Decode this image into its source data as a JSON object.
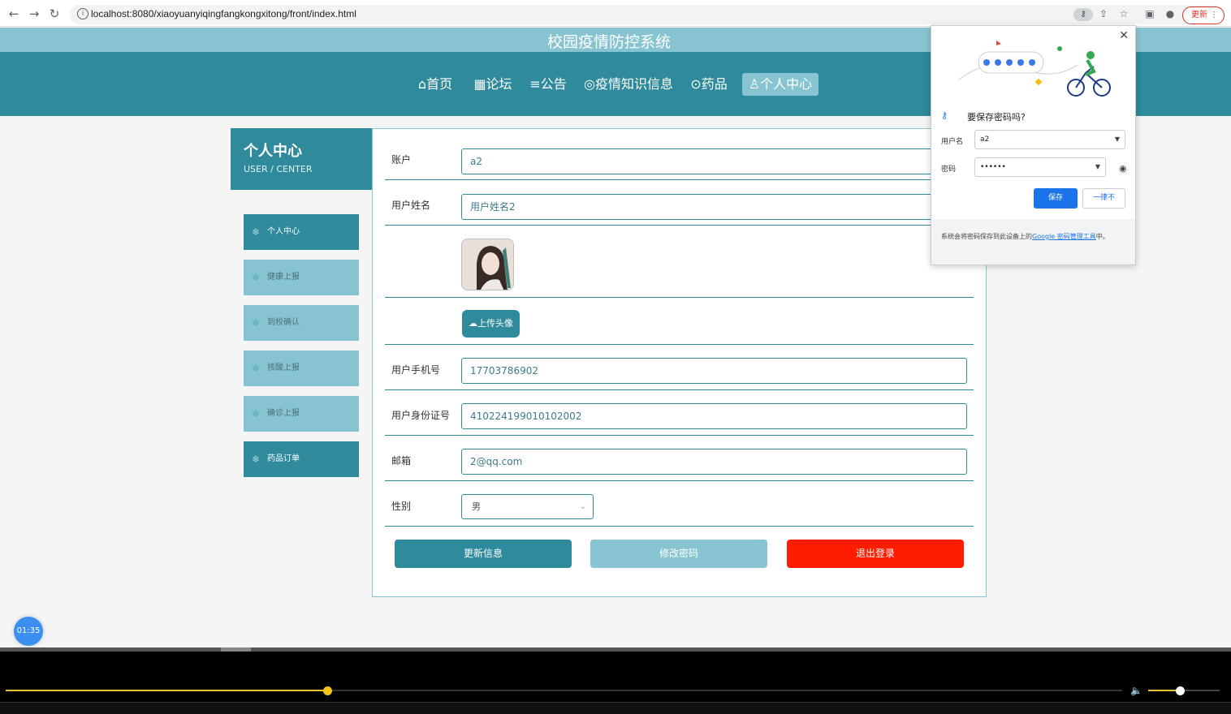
{
  "browser": {
    "url": "localhost:8080/xiaoyuanyiqingfangkongxitong/front/index.html",
    "update_label": "更新"
  },
  "site": {
    "title": "校园疫情防控系统",
    "nav": [
      {
        "label": "⌂首页"
      },
      {
        "label": "▦论坛"
      },
      {
        "label": "≡公告"
      },
      {
        "label": "◎疫情知识信息"
      },
      {
        "label": "⊙药品"
      },
      {
        "label": "♙个人中心",
        "active": true
      }
    ]
  },
  "sidebar": {
    "title": "个人中心",
    "subtitle": "USER / CENTER",
    "items": [
      {
        "label": "个人中心",
        "active": true
      },
      {
        "label": "健康上报"
      },
      {
        "label": "到校确认"
      },
      {
        "label": "核酸上报"
      },
      {
        "label": "确诊上报"
      },
      {
        "label": "药品订单",
        "active": true
      }
    ]
  },
  "form": {
    "account_label": "账户",
    "account_value": "a2",
    "name_label": "用户姓名",
    "name_value": "用户姓名2",
    "upload_label": "上传头像",
    "phone_label": "用户手机号",
    "phone_value": "17703786902",
    "idcard_label": "用户身份证号",
    "idcard_value": "410224199010102002",
    "email_label": "邮箱",
    "email_value": "2@qq.com",
    "gender_label": "性别",
    "gender_value": "男",
    "update_button": "更新信息",
    "password_button": "修改密码",
    "logout_button": "退出登录"
  },
  "password_popup": {
    "title": "要保存密码吗?",
    "username_label": "用户名",
    "username_value": "a2",
    "password_label": "密码",
    "password_value": "••••••",
    "save_button": "保存",
    "never_button": "一律不",
    "footer_text": "系统会将密码保存到此设备上的",
    "footer_link": "Google 密码管理工具",
    "footer_end": "中。"
  },
  "player": {
    "timer": "01:35",
    "progress": 0.288,
    "volume": 0.44
  },
  "colors": {
    "primary": "#2f8a9c",
    "light": "#87c4d1",
    "danger": "#ff1c00",
    "google_blue": "#1a73e8"
  }
}
